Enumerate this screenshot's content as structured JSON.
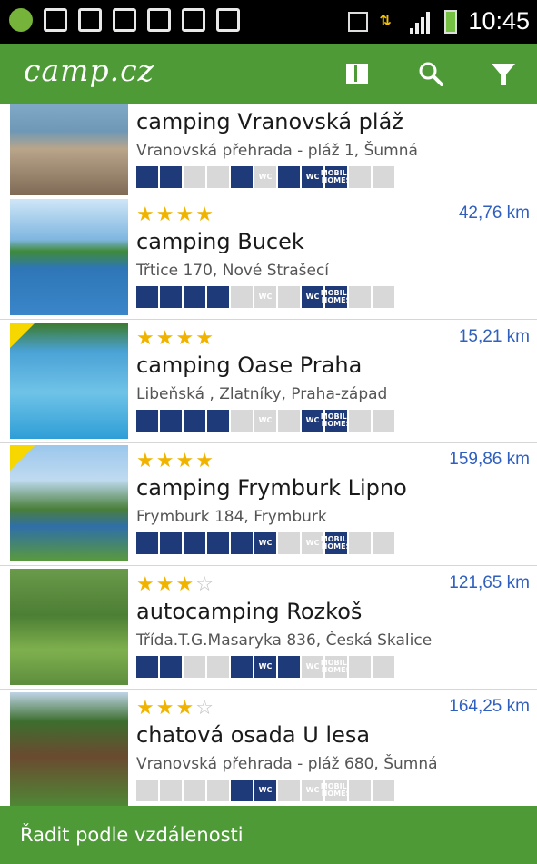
{
  "status_bar": {
    "time": "10:45",
    "left_icons": [
      "app-icon",
      "image-icon",
      "email-icon",
      "download-icon",
      "check-icon",
      "check-icon",
      "check-icon"
    ],
    "right_icons": [
      "mute-icon",
      "data-transfer-icon",
      "signal-icon",
      "battery-icon"
    ]
  },
  "appbar": {
    "logo": "camp.cz",
    "actions": [
      "map-icon",
      "search-icon",
      "filter-icon"
    ]
  },
  "colors": {
    "green": "#4d9a37",
    "distance_blue": "#2f5fbf",
    "amenity_on": "#1f3a78",
    "amenity_off": "#d8d8d8",
    "star_on": "#f0b400"
  },
  "listings": [
    {
      "name": "camping Vranovská pláž",
      "address": "Vranovská přehrada - pláž 1, Šumná",
      "stars": 0,
      "distance": "",
      "amenities": [
        1,
        1,
        0,
        0,
        1,
        0,
        1,
        1,
        1,
        0,
        0
      ],
      "featured": false
    },
    {
      "name": "camping Bucek",
      "address": "Třtice 170, Nové Strašecí",
      "stars": 4,
      "distance": "42,76 km",
      "amenities": [
        1,
        1,
        1,
        1,
        0,
        0,
        0,
        1,
        1,
        0,
        0
      ],
      "featured": false
    },
    {
      "name": "camping Oase Praha",
      "address": "Libeňská , Zlatníky, Praha-západ",
      "stars": 4,
      "distance": "15,21 km",
      "amenities": [
        1,
        1,
        1,
        1,
        0,
        0,
        0,
        1,
        1,
        0,
        0
      ],
      "featured": true
    },
    {
      "name": "camping Frymburk Lipno",
      "address": "Frymburk 184, Frymburk",
      "stars": 4,
      "distance": "159,86 km",
      "amenities": [
        1,
        1,
        1,
        1,
        1,
        1,
        0,
        0,
        1,
        0,
        0
      ],
      "featured": true
    },
    {
      "name": "autocamping Rozkoš",
      "address": "Třída.T.G.Masaryka 836, Česká Skalice",
      "stars": 3,
      "distance": "121,65 km",
      "amenities": [
        1,
        1,
        0,
        0,
        1,
        1,
        1,
        0,
        0,
        0,
        0
      ],
      "featured": false
    },
    {
      "name": "chatová osada U lesa",
      "address": "Vranovská přehrada - pláž 680, Šumná",
      "stars": 3,
      "distance": "164,25 km",
      "amenities": [
        0,
        0,
        0,
        0,
        1,
        1,
        0,
        0,
        0,
        0,
        0
      ],
      "featured": false
    }
  ],
  "amenity_labels": [
    "",
    "",
    "",
    "",
    "",
    "WC",
    "",
    "WC",
    "MOBILE HOMES",
    "",
    ""
  ],
  "bottom": {
    "sort_label": "Řadit podle vzdálenosti"
  }
}
